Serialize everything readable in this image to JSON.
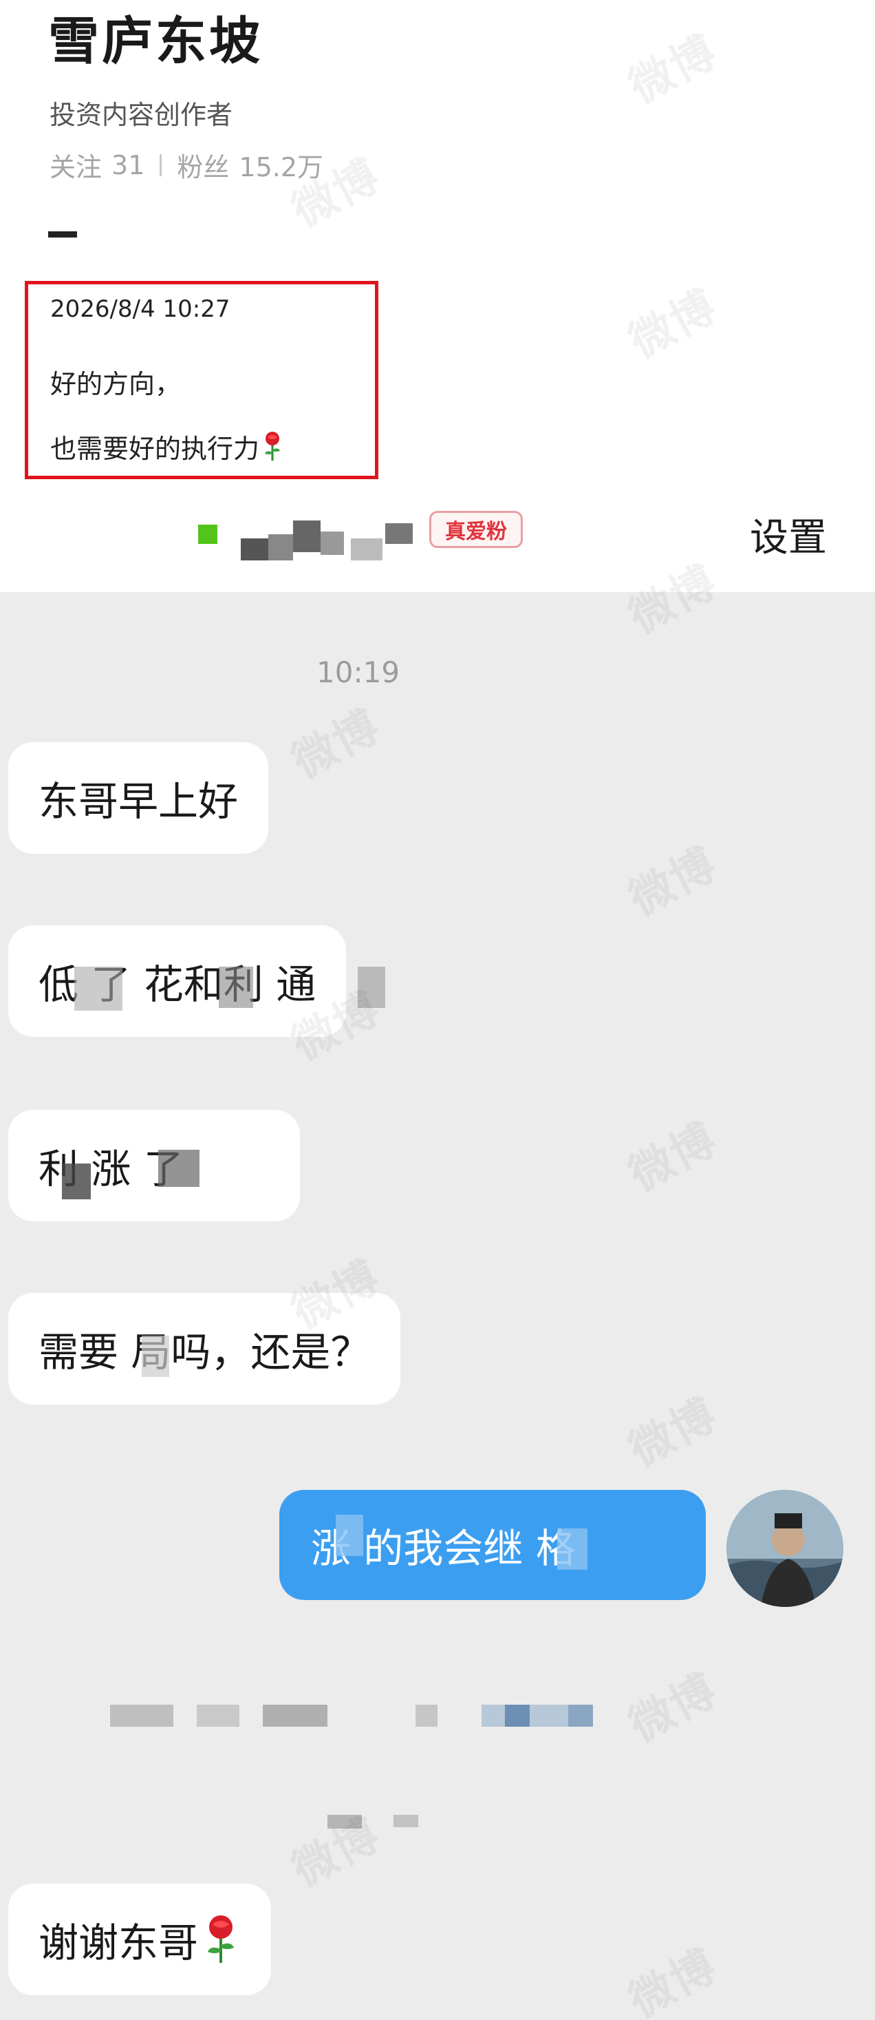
{
  "profile": {
    "name": "雪庐东坡",
    "bio": "投资内容创作者",
    "following_label": "关注",
    "following_count": "31",
    "followers_label": "粉丝",
    "followers_count": "15.2万"
  },
  "post": {
    "date": "2026/8/4 10:27",
    "line1": "好的方向，",
    "line2": "也需要好的执行力"
  },
  "chat_header": {
    "badge": "真爱粉",
    "settings": "设置"
  },
  "chat": {
    "time": "10:19",
    "messages": [
      {
        "side": "in",
        "text": "东哥早上好"
      },
      {
        "side": "in",
        "text": "低  了  花和利  通"
      },
      {
        "side": "in",
        "text": "利    涨  了"
      },
      {
        "side": "in",
        "text": "需要  局吗，还是？"
      },
      {
        "side": "out",
        "text": "涨  的我会继  格"
      },
      {
        "side": "in",
        "text": "谢谢东哥"
      }
    ]
  },
  "watermark_text": "微博",
  "colors": {
    "outgoing_bubble": "#3c9ef0",
    "highlight_border": "#e0141c",
    "badge": "#e0353e"
  }
}
